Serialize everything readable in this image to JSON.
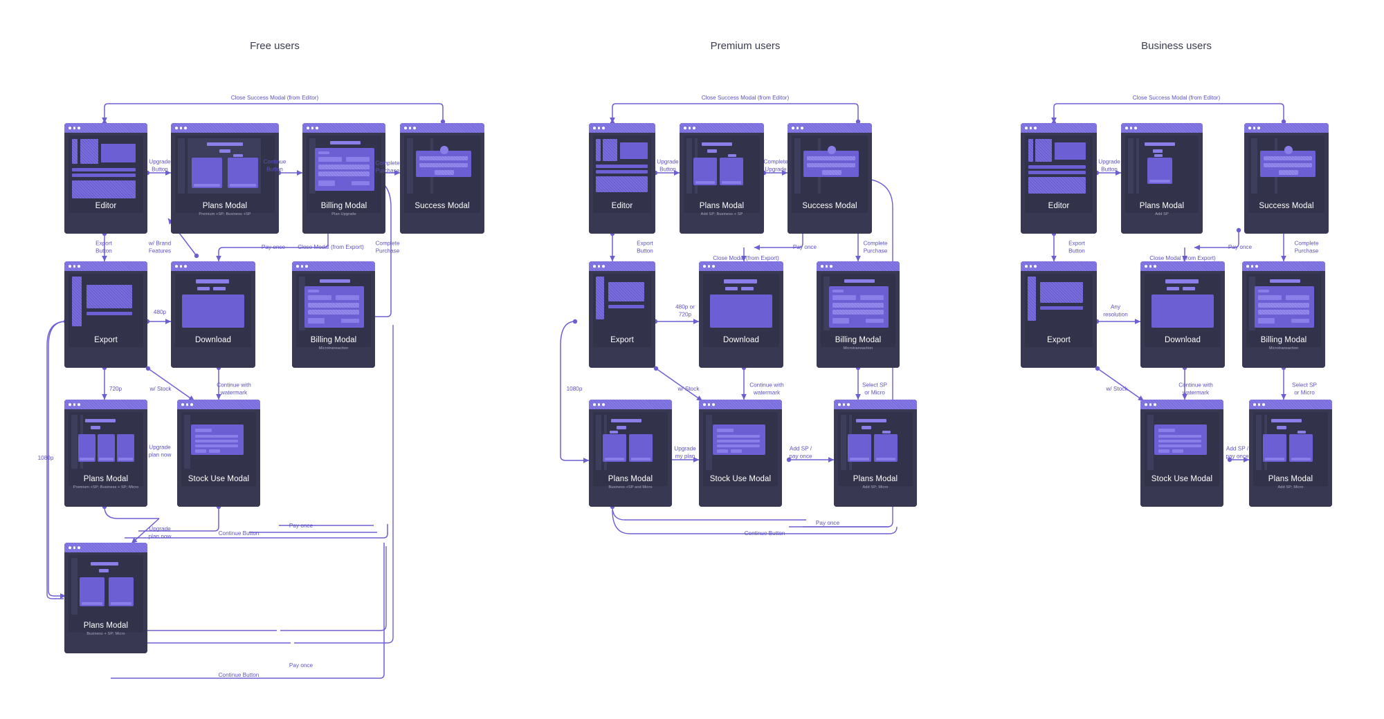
{
  "diagram": {
    "title_columns": [
      {
        "id": "free",
        "label": "Free users"
      },
      {
        "id": "premium",
        "label": "Premium users"
      },
      {
        "id": "business",
        "label": "Business users"
      }
    ],
    "accent_color": "#6c5fd4",
    "node_color": "#383853",
    "titlebar_color": "#7b6fe0",
    "wire_color": "#6c5fd4",
    "label_color": "#5b51c4",
    "background": "#ffffff"
  },
  "nodes": {
    "free": [
      {
        "id": "free-editor",
        "title": "Editor",
        "subtitle": "",
        "kind": "editor"
      },
      {
        "id": "free-plans-1",
        "title": "Plans Modal",
        "subtitle": "Premium +SP; Business +SP",
        "kind": "plans2"
      },
      {
        "id": "free-billing-1",
        "title": "Billing Modal",
        "subtitle": "Plan Upgrade",
        "kind": "billing"
      },
      {
        "id": "free-success",
        "title": "Success Modal",
        "subtitle": "",
        "kind": "success"
      },
      {
        "id": "free-export",
        "title": "Export",
        "subtitle": "",
        "kind": "export"
      },
      {
        "id": "free-download",
        "title": "Download",
        "subtitle": "",
        "kind": "download"
      },
      {
        "id": "free-billing-2",
        "title": "Billing Modal",
        "subtitle": "Microtransaction",
        "kind": "billing"
      },
      {
        "id": "free-plans-2",
        "title": "Plans Modal",
        "subtitle": "Premium +SP; Business + SP; Micro",
        "kind": "plans3"
      },
      {
        "id": "free-stock",
        "title": "Stock Use Modal",
        "subtitle": "",
        "kind": "stock"
      },
      {
        "id": "free-plans-3",
        "title": "Plans Modal",
        "subtitle": "Business + SP; Micro",
        "kind": "plans2"
      }
    ],
    "premium": [
      {
        "id": "prem-editor",
        "title": "Editor",
        "subtitle": "",
        "kind": "editor"
      },
      {
        "id": "prem-plans-1",
        "title": "Plans Modal",
        "subtitle": "Add SP; Business + SP",
        "kind": "plans2"
      },
      {
        "id": "prem-success",
        "title": "Success Modal",
        "subtitle": "",
        "kind": "success"
      },
      {
        "id": "prem-export",
        "title": "Export",
        "subtitle": "",
        "kind": "export"
      },
      {
        "id": "prem-download",
        "title": "Download",
        "subtitle": "",
        "kind": "download"
      },
      {
        "id": "prem-billing",
        "title": "Billing Modal",
        "subtitle": "Microtransaction",
        "kind": "billing"
      },
      {
        "id": "prem-plans-2",
        "title": "Plans Modal",
        "subtitle": "Business +SP and Micro",
        "kind": "plans2"
      },
      {
        "id": "prem-stock",
        "title": "Stock Use Modal",
        "subtitle": "",
        "kind": "stock"
      },
      {
        "id": "prem-plans-3",
        "title": "Plans Modal",
        "subtitle": "Add SP; Micro",
        "kind": "plans2"
      }
    ],
    "business": [
      {
        "id": "biz-editor",
        "title": "Editor",
        "subtitle": "",
        "kind": "editor"
      },
      {
        "id": "biz-plans-1",
        "title": "Plans Modal",
        "subtitle": "Add SP",
        "kind": "plans1"
      },
      {
        "id": "biz-success",
        "title": "Success Modal",
        "subtitle": "",
        "kind": "success"
      },
      {
        "id": "biz-export",
        "title": "Export",
        "subtitle": "",
        "kind": "export"
      },
      {
        "id": "biz-download",
        "title": "Download",
        "subtitle": "",
        "kind": "download"
      },
      {
        "id": "biz-billing",
        "title": "Billing Modal",
        "subtitle": "Microtransaction",
        "kind": "billing"
      },
      {
        "id": "biz-stock",
        "title": "Stock Use Modal",
        "subtitle": "",
        "kind": "stock"
      },
      {
        "id": "biz-plans-2",
        "title": "Plans Modal",
        "subtitle": "Add SP; Micro",
        "kind": "plans2"
      }
    ]
  },
  "edge_labels": {
    "free": [
      {
        "id": "f-l1",
        "text": "Close Success Modal (from Editor)"
      },
      {
        "id": "f-l2",
        "text": "Upgrade\nButton"
      },
      {
        "id": "f-l3",
        "text": "Continue\nButton"
      },
      {
        "id": "f-l4",
        "text": "Complete\nPurchase"
      },
      {
        "id": "f-l5",
        "text": "Export\nButton"
      },
      {
        "id": "f-l6",
        "text": "w/ Brand\nFeatures"
      },
      {
        "id": "f-l7",
        "text": "Pay once"
      },
      {
        "id": "f-l8",
        "text": "Close Modal (from Export)"
      },
      {
        "id": "f-l9",
        "text": "Complete\nPurchase"
      },
      {
        "id": "f-l10",
        "text": "480p"
      },
      {
        "id": "f-l11",
        "text": "720p"
      },
      {
        "id": "f-l12",
        "text": "w/ Stock"
      },
      {
        "id": "f-l13",
        "text": "Continue with\nwatermark"
      },
      {
        "id": "f-l14",
        "text": "1080p"
      },
      {
        "id": "f-l15",
        "text": "Upgrade\nplan now"
      },
      {
        "id": "f-l16",
        "text": "Upgrade\nplan now"
      },
      {
        "id": "f-l17",
        "text": "Continue Button"
      },
      {
        "id": "f-l18",
        "text": "Pay once"
      },
      {
        "id": "f-l19",
        "text": "Continue Button"
      },
      {
        "id": "f-l20",
        "text": "Pay once"
      }
    ],
    "premium": [
      {
        "id": "p-l1",
        "text": "Close Success Modal (from Editor)"
      },
      {
        "id": "p-l2",
        "text": "Upgrade\nButton"
      },
      {
        "id": "p-l3",
        "text": "Complete\nUpgrade"
      },
      {
        "id": "p-l4",
        "text": "Export\nButton"
      },
      {
        "id": "p-l5",
        "text": "Close Modal (from Export)"
      },
      {
        "id": "p-l6",
        "text": "Pay once"
      },
      {
        "id": "p-l7",
        "text": "Complete\nPurchase"
      },
      {
        "id": "p-l8",
        "text": "480p or\n720p"
      },
      {
        "id": "p-l9",
        "text": "1080p"
      },
      {
        "id": "p-l10",
        "text": "w/ Stock"
      },
      {
        "id": "p-l11",
        "text": "Continue with\nwatermark"
      },
      {
        "id": "p-l12",
        "text": "Select SP\nor Micro"
      },
      {
        "id": "p-l13",
        "text": "Upgrade\nmy plan"
      },
      {
        "id": "p-l14",
        "text": "Add SP /\npay once"
      },
      {
        "id": "p-l15",
        "text": "Pay once"
      },
      {
        "id": "p-l16",
        "text": "Continue Button"
      }
    ],
    "business": [
      {
        "id": "b-l1",
        "text": "Close Success Modal (from Editor)"
      },
      {
        "id": "b-l2",
        "text": "Upgrade\nButton"
      },
      {
        "id": "b-l3",
        "text": "Export\nButton"
      },
      {
        "id": "b-l4",
        "text": "Close Modal (from Export)"
      },
      {
        "id": "b-l5",
        "text": "Pay once"
      },
      {
        "id": "b-l6",
        "text": "Complete\nPurchase"
      },
      {
        "id": "b-l7",
        "text": "Any\nresolution"
      },
      {
        "id": "b-l8",
        "text": "w/ Stock"
      },
      {
        "id": "b-l9",
        "text": "Continue with\nwatermark"
      },
      {
        "id": "b-l10",
        "text": "Select SP\nor Micro"
      },
      {
        "id": "b-l11",
        "text": "Add SP /\npay once"
      }
    ]
  }
}
